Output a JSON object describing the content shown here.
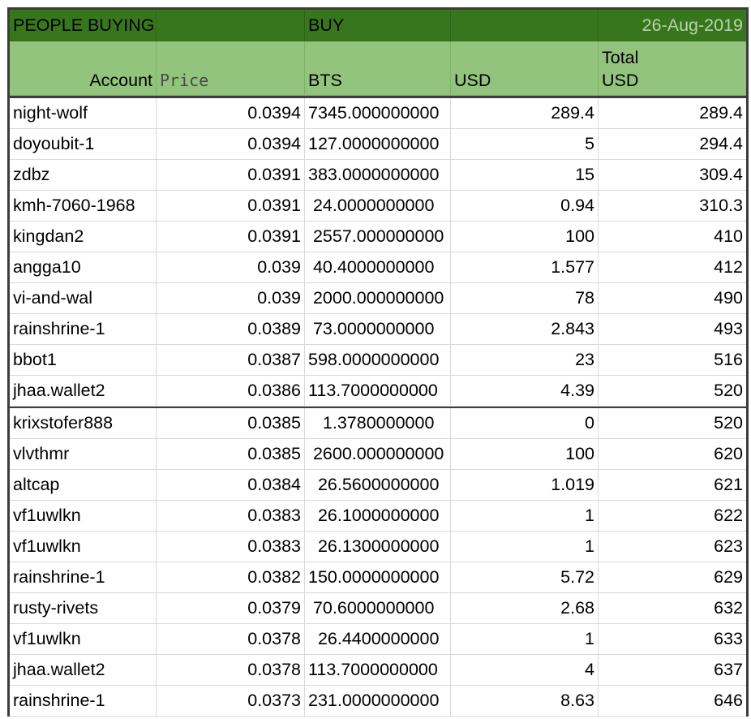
{
  "title_row": {
    "label": "PEOPLE BUYING",
    "action": "BUY",
    "date": "26-Aug-2019",
    "accent_color": "#38761d",
    "header_color": "#93c47d"
  },
  "columns": {
    "account": "Account",
    "price": "Price",
    "bts": "BTS",
    "usd": "USD",
    "total_line1": "Total",
    "total_line2": "USD"
  },
  "rows": [
    {
      "account": "night-wolf",
      "price": "0.0394",
      "bts": "7345.000000000",
      "usd": "289.4",
      "total": "289.4"
    },
    {
      "account": "doyoubit-1",
      "price": "0.0394",
      "bts": "127.0000000000",
      "usd": "5",
      "total": "294.4"
    },
    {
      "account": "zdbz",
      "price": "0.0391",
      "bts": "383.0000000000",
      "usd": "15",
      "total": "309.4"
    },
    {
      "account": "kmh-7060-1968",
      "price": "0.0391",
      "bts": " 24.0000000000",
      "usd": "0.94",
      "total": "310.3"
    },
    {
      "account": "kingdan2",
      "price": "0.0391",
      "bts": " 2557.000000000",
      "usd": "100",
      "total": "410"
    },
    {
      "account": "angga10",
      "price": "0.039",
      "bts": " 40.4000000000",
      "usd": "1.577",
      "total": "412"
    },
    {
      "account": "vi-and-wal",
      "price": "0.039",
      "bts": " 2000.000000000",
      "usd": "78",
      "total": "490"
    },
    {
      "account": "rainshrine-1",
      "price": "0.0389",
      "bts": " 73.0000000000",
      "usd": "2.843",
      "total": "493"
    },
    {
      "account": "bbot1",
      "price": "0.0387",
      "bts": "598.0000000000",
      "usd": "23",
      "total": "516"
    },
    {
      "account": "jhaa.wallet2",
      "price": "0.0386",
      "bts": "113.7000000000",
      "usd": "4.39",
      "total": "520"
    },
    {
      "account": "krixstofer888",
      "price": "0.0385",
      "bts": "   1.3780000000",
      "usd": "0",
      "total": "520"
    },
    {
      "account": "vlvthmr",
      "price": "0.0385",
      "bts": " 2600.000000000",
      "usd": "100",
      "total": "620"
    },
    {
      "account": "altcap",
      "price": "0.0384",
      "bts": "  26.5600000000",
      "usd": "1.019",
      "total": "621"
    },
    {
      "account": "vf1uwlkn",
      "price": "0.0383",
      "bts": "  26.1000000000",
      "usd": "1",
      "total": "622"
    },
    {
      "account": "vf1uwlkn",
      "price": "0.0383",
      "bts": "  26.1300000000",
      "usd": "1",
      "total": "623"
    },
    {
      "account": "rainshrine-1",
      "price": "0.0382",
      "bts": "150.0000000000",
      "usd": "5.72",
      "total": "629"
    },
    {
      "account": "rusty-rivets",
      "price": "0.0379",
      "bts": " 70.6000000000",
      "usd": "2.68",
      "total": "632"
    },
    {
      "account": "vf1uwlkn",
      "price": "0.0378",
      "bts": "  26.4400000000",
      "usd": "1",
      "total": "633"
    },
    {
      "account": "jhaa.wallet2",
      "price": "0.0378",
      "bts": "113.7000000000",
      "usd": "4",
      "total": "637"
    },
    {
      "account": "rainshrine-1",
      "price": "0.0373",
      "bts": "231.0000000000",
      "usd": "8.63",
      "total": "646"
    }
  ]
}
